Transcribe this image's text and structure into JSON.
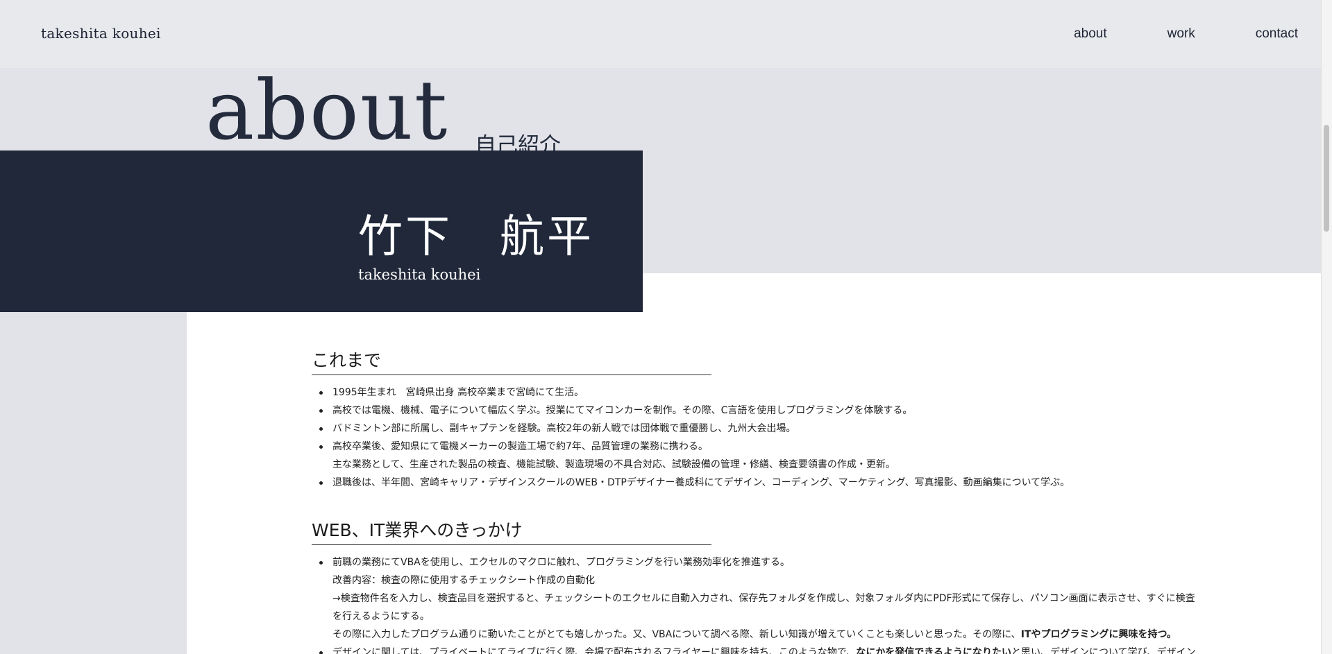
{
  "header": {
    "logo": "takeshita kouhei",
    "nav": [
      "about",
      "work",
      "contact"
    ]
  },
  "hero": {
    "title": "about",
    "subtitle": "自己紹介",
    "name_jp": "竹下　航平",
    "name_en": "takeshita kouhei"
  },
  "sections": [
    {
      "title": "これまで",
      "items": [
        [
          "1995年生まれ　宮崎県出身 高校卒業まで宮崎にて生活。"
        ],
        [
          "高校では電機、機械、電子について幅広く学ぶ。授業にてマイコンカーを制作。その際、C言語を使用しプログラミングを体験する。"
        ],
        [
          "バドミントン部に所属し、副キャプテンを経験。高校2年の新人戦では団体戦で重優勝し、九州大会出場。"
        ],
        [
          "高校卒業後、愛知県にて電機メーカーの製造工場で約7年、品質管理の業務に携わる。",
          "主な業務として、生産された製品の検査、機能試験、製造現場の不具合対応、試験設備の管理・修繕、検査要領書の作成・更新。"
        ],
        [
          "退職後は、半年間、宮崎キャリア・デザインスクールのWEB・DTPデザイナー養成科にてデザイン、コーディング、マーケティング、写真撮影、動画編集について学ぶ。"
        ]
      ]
    },
    {
      "title": "WEB、IT業界へのきっかけ",
      "item1": {
        "l1": "前職の業務にてVBAを使用し、エクセルのマクロに触れ、プログラミングを行い業務効率化を推進する。",
        "l2": "改善内容：検査の際に使用するチェックシート作成の自動化",
        "l3": "→検査物件名を入力し、検査品目を選択すると、チェックシートのエクセルに自動入力され、保存先フォルダを作成し、対象フォルダ内にPDF形式にて保存し、パソコン画面に表示させ、すぐに検査を行えるようにする。",
        "l4a": "その際に入力したプログラム通りに動いたことがとても嬉しかった。又、VBAについて調べる際、新しい知識が増えていくことも楽しいと思った。その際に、",
        "l4b": "ITやプログラミングに興味を持つ。"
      },
      "item2": {
        "a": "デザインに関しては、プライベートにてライブに行く際、会場で配布されるフライヤーに興味を持ち、このような物で、",
        "b": "なにかを発信できるようになりたい",
        "c": "と思い、デザインについて学び、デザイン"
      }
    }
  ],
  "colors": {
    "navy": "#20283a",
    "band": "#e2e3e8",
    "header": "#e8e9ec"
  }
}
